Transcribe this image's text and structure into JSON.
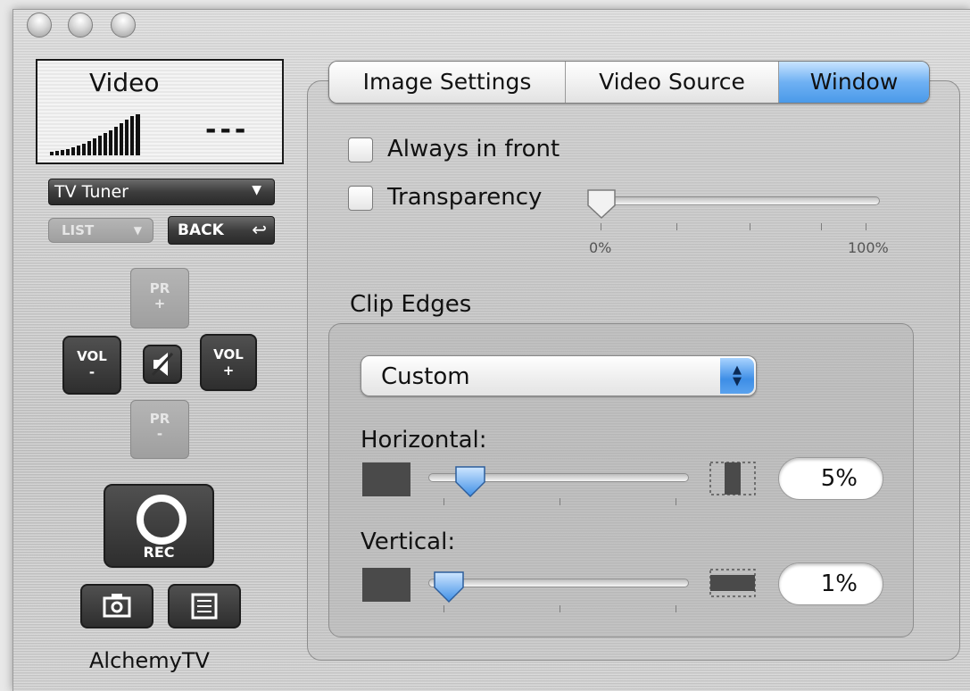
{
  "lcd": {
    "title": "Video",
    "channel_display": "---"
  },
  "source_select": {
    "value": "TV Tuner"
  },
  "buttons": {
    "list": "LIST",
    "back": "BACK",
    "pr_plus_top": "PR",
    "pr_plus_bottom": "+",
    "pr_minus_top": "PR",
    "pr_minus_bottom": "-",
    "vol_minus_top": "VOL",
    "vol_minus_bottom": "-",
    "vol_plus_top": "VOL",
    "vol_plus_bottom": "+",
    "rec": "REC"
  },
  "app_name": "AlchemyTV",
  "tabs": [
    {
      "label": "Image Settings",
      "active": false
    },
    {
      "label": "Video Source",
      "active": false
    },
    {
      "label": "Window",
      "active": true
    }
  ],
  "window_tab": {
    "always_in_front": {
      "label": "Always in front",
      "checked": false
    },
    "transparency": {
      "label": "Transparency",
      "checked": false,
      "min_label": "0%",
      "max_label": "100%",
      "value_fraction": 0.0
    },
    "clip_edges": {
      "title": "Clip Edges",
      "mode": "Custom",
      "horizontal": {
        "label": "Horizontal:",
        "value": "5%",
        "value_fraction": 0.14
      },
      "vertical": {
        "label": "Vertical:",
        "value": "1%",
        "value_fraction": 0.04
      }
    }
  },
  "colors": {
    "tab_active": "#4a9ae9",
    "slider_thumb": "#5aa6f0"
  }
}
